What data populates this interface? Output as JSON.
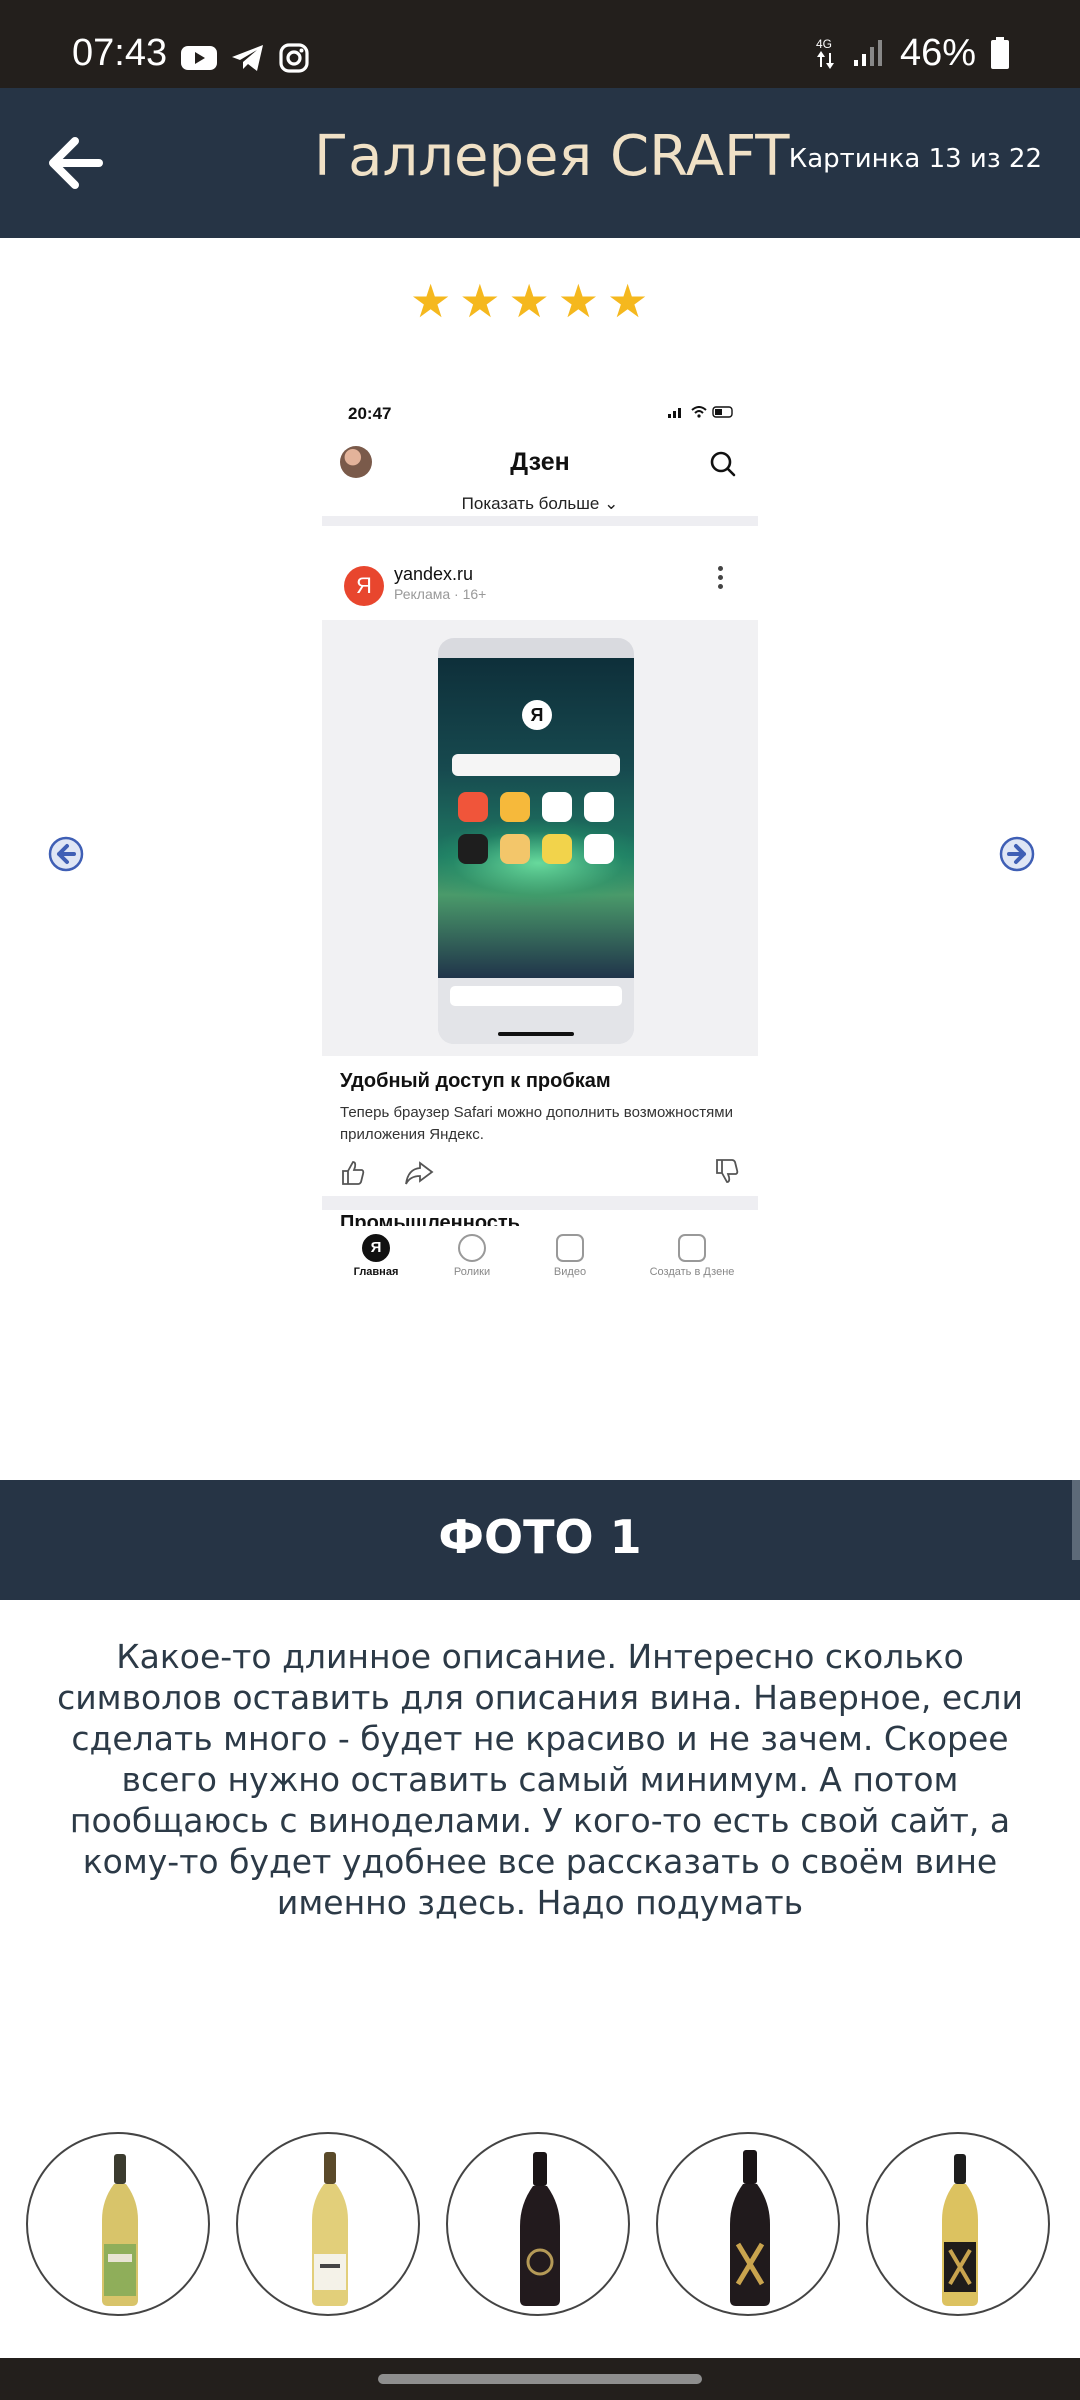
{
  "status_bar": {
    "time": "07:43",
    "network": "4G",
    "battery": "46%",
    "left_icons": [
      "youtube-icon",
      "telegram-icon",
      "instagram-icon"
    ],
    "right_icons": [
      "data-arrows-icon",
      "signal-icon",
      "battery-icon"
    ]
  },
  "header": {
    "back_icon": "back-arrow-icon",
    "title": "Галлерея CRAFT",
    "counter": "Картинка 13 из 22"
  },
  "rating": {
    "stars": 5,
    "max": 5,
    "color": "#f5b81e"
  },
  "gallery": {
    "prev_icon": "circle-arrow-left-icon",
    "next_icon": "circle-arrow-right-icon",
    "image": {
      "time": "20:47",
      "app_title": "Дзен",
      "show_more": "Показать больше",
      "source": "yandex.ru",
      "ad_label": "Реклама · 16+",
      "logo_letter": "Я",
      "headline": "Удобный доступ к пробкам",
      "description": "Теперь браузер Safari можно дополнить возможностями приложения Яндекс.",
      "next_headline": "Промышленность",
      "tabs": [
        "Главная",
        "Ролики",
        "Видео",
        "Создать в Дзене"
      ]
    }
  },
  "photo": {
    "title": "ФОТО 1",
    "description": "Какое-то длинное описание. Интересно сколько символов оставить для описания вина. Наверное, если сделать много - будет не красиво и не зачем. Скорее всего нужно оставить самый минимум. А потом пообщаюсь с виноделами. У кого-то есть свой сайт, а кому-то будет удобнее все рассказать о своём вине именно здесь. Надо подумать"
  },
  "thumbnails": [
    {
      "name": "wine-thumb-1",
      "wine": "white"
    },
    {
      "name": "wine-thumb-2",
      "wine": "white"
    },
    {
      "name": "wine-thumb-3",
      "wine": "red"
    },
    {
      "name": "wine-thumb-4",
      "wine": "red"
    },
    {
      "name": "wine-thumb-5",
      "wine": "white"
    }
  ],
  "colors": {
    "header_bg": "#263445",
    "header_title": "#f0e1c6",
    "star": "#f5b81e",
    "status_bar_bg": "#231f1c"
  }
}
